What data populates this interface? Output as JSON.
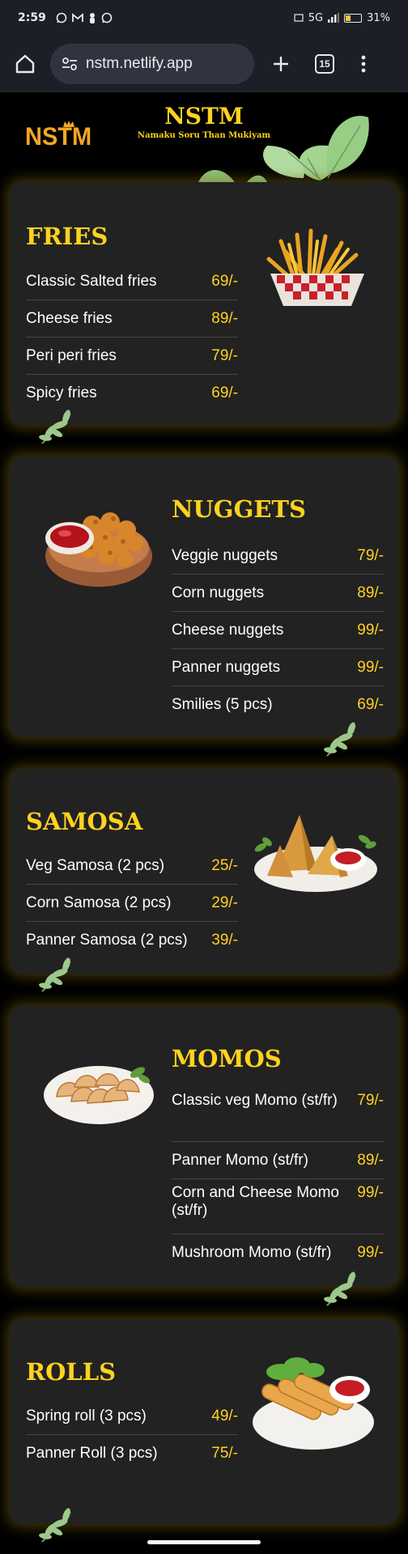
{
  "status": {
    "time": "2:59",
    "network": "5G",
    "battery": "31%",
    "battery_level": 0.31
  },
  "browser": {
    "url": "nstm.netlify.app",
    "tab_count": "15"
  },
  "header": {
    "logo": "NSTM",
    "title": "NSTM",
    "subtitle": "Namaku Soru Than Mukiyam"
  },
  "sections": [
    {
      "title": "FRIES",
      "image": "fries-basket",
      "items": [
        {
          "name": "Classic Salted fries",
          "price": "69/-"
        },
        {
          "name": "Cheese fries",
          "price": "89/-"
        },
        {
          "name": "Peri peri fries",
          "price": "79/-"
        },
        {
          "name": "Spicy fries",
          "price": "69/-"
        }
      ]
    },
    {
      "title": "NUGGETS",
      "image": "nuggets-bowl",
      "items": [
        {
          "name": "Veggie nuggets",
          "price": "79/-"
        },
        {
          "name": "Corn nuggets",
          "price": "89/-"
        },
        {
          "name": "Cheese nuggets",
          "price": "99/-"
        },
        {
          "name": "Panner nuggets",
          "price": "99/-"
        },
        {
          "name": "Smilies (5 pcs)",
          "price": "69/-"
        }
      ]
    },
    {
      "title": "SAMOSA",
      "image": "samosa-plate",
      "items": [
        {
          "name": "Veg Samosa (2 pcs)",
          "price": "25/-"
        },
        {
          "name": "Corn Samosa (2 pcs)",
          "price": "29/-"
        },
        {
          "name": "Panner Samosa (2 pcs)",
          "price": "39/-"
        }
      ]
    },
    {
      "title": "MOMOS",
      "image": "momos-plate",
      "items": [
        {
          "name": "Classic veg Momo (st/fr)",
          "price": "79/-"
        },
        {
          "name": "Panner Momo (st/fr)",
          "price": "89/-"
        },
        {
          "name": "Corn and Cheese Momo (st/fr)",
          "price": "99/-"
        },
        {
          "name": "Mushroom Momo (st/fr)",
          "price": "99/-"
        }
      ]
    },
    {
      "title": "ROLLS",
      "image": "spring-rolls-plate",
      "items": [
        {
          "name": "Spring roll (3 pcs)",
          "price": "49/-"
        },
        {
          "name": "Panner Roll (3 pcs)",
          "price": "75/-"
        }
      ]
    }
  ],
  "colors": {
    "accent": "#ffd21f",
    "card": "#222222",
    "background": "#000000"
  }
}
